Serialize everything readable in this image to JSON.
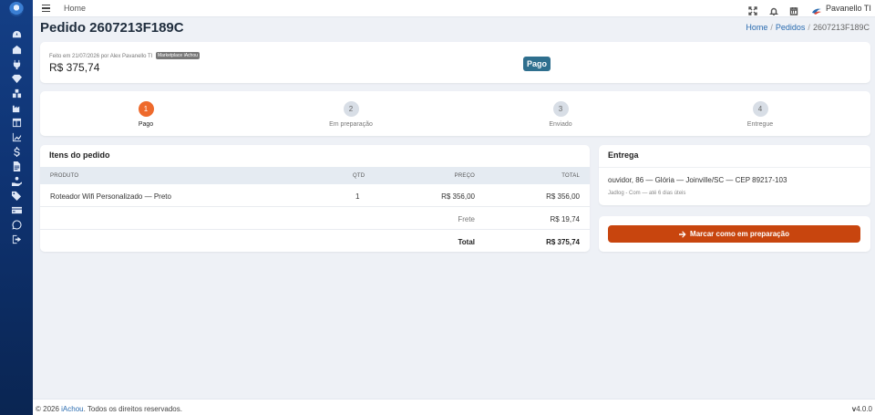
{
  "topbar": {
    "home_label": "Home",
    "user_name": "Pavanello TI"
  },
  "header": {
    "title": "Pedido 2607213F189C",
    "breadcrumb": [
      {
        "label": "Home"
      },
      {
        "label": "Pedidos"
      },
      {
        "label": "2607213F189C"
      }
    ]
  },
  "summary": {
    "meta": "Feito em 21/07/2026 por Alex Pavanello TI",
    "marketplace_badge": "Marketplace iAchou",
    "amount": "R$ 375,74",
    "status": "Pago"
  },
  "steps": [
    {
      "num": "1",
      "label": "Pago",
      "active": true
    },
    {
      "num": "2",
      "label": "Em preparação",
      "active": false
    },
    {
      "num": "3",
      "label": "Enviado",
      "active": false
    },
    {
      "num": "4",
      "label": "Entregue",
      "active": false
    }
  ],
  "items": {
    "title": "Itens do pedido",
    "columns": [
      "Produto",
      "Qtd",
      "Preço",
      "Total"
    ],
    "rows": [
      {
        "produto": "Roteador Wifi Personalizado — Preto",
        "qtd": "1",
        "preco": "R$ 356,00",
        "total": "R$ 356,00"
      }
    ],
    "frete_label": "Frete",
    "frete_value": "R$ 19,74",
    "total_label": "Total",
    "total_value": "R$ 375,74"
  },
  "delivery": {
    "title": "Entrega",
    "address": "ouvidor, 86 — Glória — Joinville/SC — CEP 89217-103",
    "carrier": "Jadlog - Com — até 6 dias úteis"
  },
  "action": {
    "label": "Marcar como em preparação"
  },
  "footer": {
    "prefix": "© 2026 ",
    "brand": "iAchou",
    "suffix": ". Todos os direitos reservados.",
    "version_prefix": "v",
    "version": "4.0.0"
  },
  "colors": {
    "accent": "#ee6a2c",
    "action": "#c8450e",
    "status_badge": "#2f6f8e",
    "sidebar": "#0f3474"
  }
}
